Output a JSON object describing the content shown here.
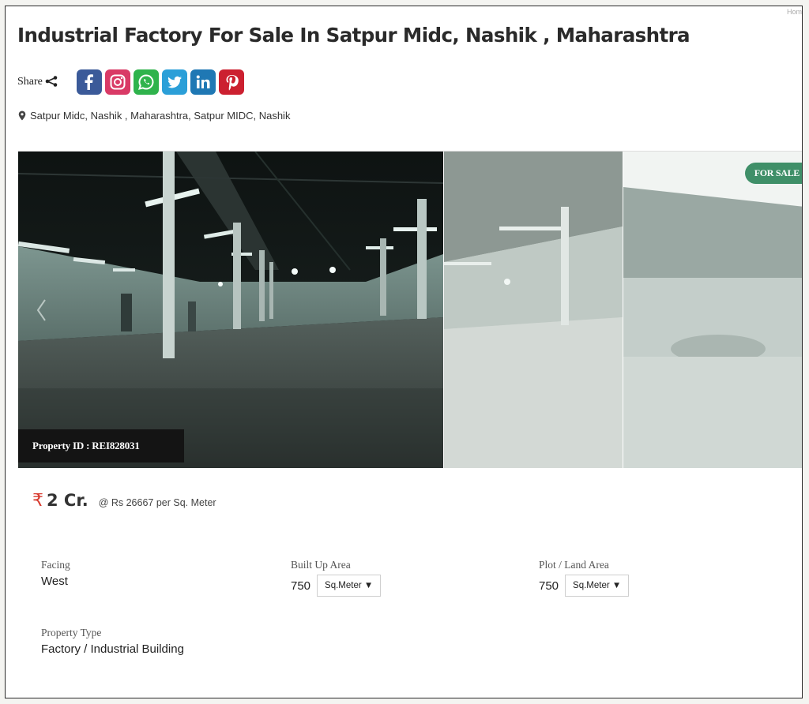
{
  "header": {
    "corner_text": "Hom",
    "title": "Industrial Factory For Sale In Satpur Midc, Nashik , Maharashtra"
  },
  "share": {
    "label": "Share",
    "networks": [
      {
        "name": "facebook",
        "icon": "facebook-icon",
        "color": "#3b5a99"
      },
      {
        "name": "instagram",
        "icon": "instagram-icon",
        "color": "#d93a66"
      },
      {
        "name": "whatsapp",
        "icon": "whatsapp-icon",
        "color": "#2fb34c"
      },
      {
        "name": "twitter",
        "icon": "twitter-icon",
        "color": "#2b9fd8"
      },
      {
        "name": "linkedin",
        "icon": "linkedin-icon",
        "color": "#1f78b4"
      },
      {
        "name": "pinterest",
        "icon": "pinterest-icon",
        "color": "#cc2030"
      }
    ]
  },
  "location": {
    "icon": "map-pin-icon",
    "text": "Satpur Midc, Nashik , Maharashtra, Satpur MIDC, Nashik"
  },
  "gallery": {
    "badge": "FOR SALE",
    "property_id_label": "Property ID : REI828031",
    "prev_icon": "chevron-left-icon"
  },
  "price": {
    "currency_symbol": "₹",
    "amount": "2 Cr.",
    "rate": "@ Rs 26667 per Sq. Meter"
  },
  "details": {
    "facing_label": "Facing",
    "facing_value": "West",
    "built_up_label": "Built Up Area",
    "built_up_value": "750",
    "built_up_unit": "Sq.Meter ▼",
    "plot_label": "Plot / Land Area",
    "plot_value": "750",
    "plot_unit": "Sq.Meter ▼",
    "type_label": "Property Type",
    "type_value": "Factory / Industrial Building"
  },
  "colors": {
    "accent": "#d83b2f",
    "badge": "#3f8f68"
  }
}
